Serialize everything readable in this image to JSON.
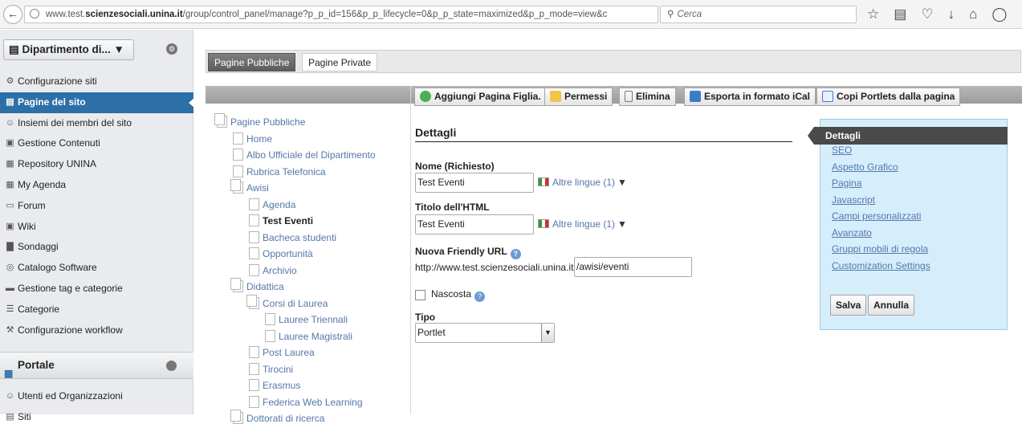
{
  "browser": {
    "url_prefix": "www.test.",
    "url_domain": "scienzesociali.unina.it",
    "url_rest": "/group/control_panel/manage?p_p_id=156&p_p_lifecycle=0&p_p_state=maximized&p_p_mode=view&c",
    "search_placeholder": "Cerca"
  },
  "sidebar": {
    "site_selector": "Dipartimento di...",
    "items": [
      {
        "label": "Configurazione siti",
        "icon": "gear-icon"
      },
      {
        "label": "Pagine del sito",
        "icon": "pages-icon",
        "active": true
      },
      {
        "label": "Insiemi dei membri del sito",
        "icon": "users-icon"
      },
      {
        "label": "Gestione Contenuti",
        "icon": "content-icon"
      },
      {
        "label": "Repository UNINA",
        "icon": "repository-icon"
      },
      {
        "label": "My Agenda",
        "icon": "calendar-icon"
      },
      {
        "label": "Forum",
        "icon": "forum-icon"
      },
      {
        "label": "Wiki",
        "icon": "wiki-icon"
      },
      {
        "label": "Sondaggi",
        "icon": "poll-icon"
      },
      {
        "label": "Catalogo Software",
        "icon": "software-icon"
      },
      {
        "label": "Gestione tag e categorie",
        "icon": "tag-icon"
      },
      {
        "label": "Categorie",
        "icon": "categories-icon"
      },
      {
        "label": "Configurazione workflow",
        "icon": "workflow-icon"
      }
    ],
    "portale_label": "Portale",
    "portale_items": [
      {
        "label": "Utenti ed Organizzazioni",
        "icon": "user-icon"
      },
      {
        "label": "Siti",
        "icon": "sites-icon"
      }
    ]
  },
  "tabs": {
    "public": "Pagine Pubbliche",
    "private": "Pagine Private"
  },
  "tree": [
    {
      "label": "Pagine Pubbliche",
      "level": 0,
      "folder": true
    },
    {
      "label": "Home",
      "level": 1
    },
    {
      "label": "Albo Ufficiale del Dipartimento",
      "level": 1
    },
    {
      "label": "Rubrica Telefonica",
      "level": 1
    },
    {
      "label": "Awisi",
      "level": 1,
      "folder": true
    },
    {
      "label": "Agenda",
      "level": 2
    },
    {
      "label": "Test Eventi",
      "level": 2,
      "selected": true
    },
    {
      "label": "Bacheca studenti",
      "level": 2
    },
    {
      "label": "Opportunità",
      "level": 2
    },
    {
      "label": "Archivio",
      "level": 2
    },
    {
      "label": "Didattica",
      "level": 1,
      "folder": true
    },
    {
      "label": "Corsi di Laurea",
      "level": 2,
      "folder": true
    },
    {
      "label": "Lauree Triennali",
      "level": 3
    },
    {
      "label": "Lauree Magistrali",
      "level": 3
    },
    {
      "label": "Post Laurea",
      "level": 2
    },
    {
      "label": "Tirocini",
      "level": 2
    },
    {
      "label": "Erasmus",
      "level": 2
    },
    {
      "label": "Federica Web Learning",
      "level": 2
    },
    {
      "label": "Dottorati di ricerca",
      "level": 1,
      "folder": true
    }
  ],
  "toolbar": {
    "add_child": "Aggiungi Pagina Figlia.",
    "permissions": "Permessi",
    "delete": "Elimina",
    "export_ical": "Esporta in formato iCal",
    "copy_portlets": "Copi Portlets dalla pagina"
  },
  "details": {
    "title": "Dettagli",
    "name_label": "Nome (Richiesto)",
    "name_value": "Test Eventi",
    "html_title_label": "Titolo dell'HTML",
    "html_title_value": "Test Eventi",
    "other_langs": "Altre lingue (1)",
    "friendly_url_label": "Nuova Friendly URL",
    "url_prefix": "http://www.test.scienzesociali.unina.it",
    "friendly_url_value": "/awisi/eventi",
    "hidden_label": "Nascosta",
    "type_label": "Tipo",
    "type_value": "Portlet"
  },
  "right_panel": {
    "header": "Dettagli",
    "links": [
      "SEO",
      "Aspetto Grafico",
      "Pagina",
      "Javascript",
      "Campi personalizzati",
      "Avanzato",
      "Gruppi mobili di regola",
      "Customization Settings"
    ],
    "save": "Salva",
    "cancel": "Annulla"
  }
}
